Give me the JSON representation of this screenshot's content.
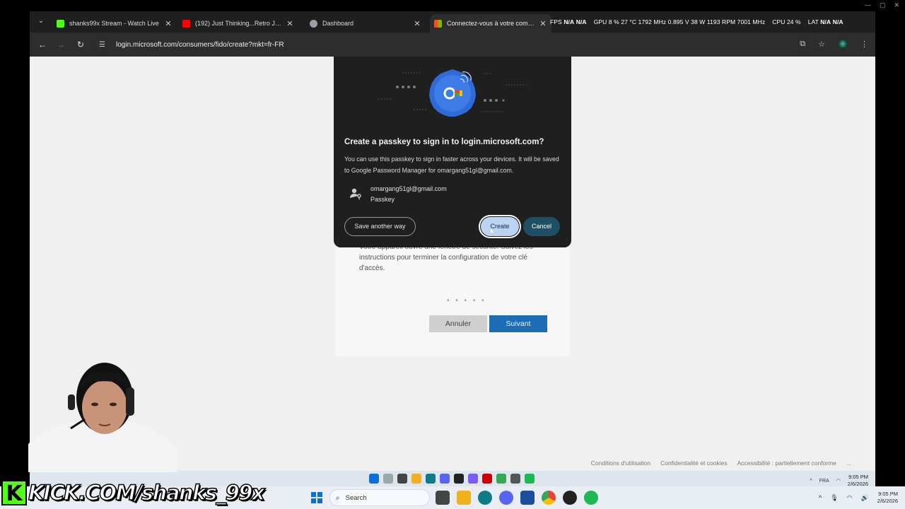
{
  "browser": {
    "tabs": [
      {
        "title": "shanks99x Stream - Watch Live",
        "favicon_color": "#53fc18",
        "active": false
      },
      {
        "title": "(192) Just Thinking...Retro Jazz",
        "favicon_color": "#ff0000",
        "active": false
      },
      {
        "title": "Dashboard",
        "favicon_color": "#9aa0a6",
        "active": false
      },
      {
        "title": "Connectez-vous à votre compte",
        "favicon_color": "#f25022",
        "active": true
      }
    ],
    "url": "login.microsoft.com/consumers/fido/create?mkt=fr-FR"
  },
  "overlay_stats": {
    "fps": "FPS",
    "fps_value": "N/A",
    "fps_value2": "N/A",
    "gpu": "GPU",
    "gpu_load": "8 %",
    "gpu_temp": "27 °C",
    "gpu_clock": "1792 MHz",
    "gpu_volt": "0.895 V",
    "gpu_power": "38 W",
    "gpu_rpm": "1193 RPM",
    "gpu_mem": "7001 MHz",
    "cpu": "CPU",
    "cpu_load": "24 %",
    "lat": "LAT",
    "lat_value": "N/A",
    "lat_value2": "N/A"
  },
  "passkey_dialog": {
    "title": "Create a passkey to sign in to login.microsoft.com?",
    "description": "You can use this passkey to sign in faster across your devices. It will be saved to Google Password Manager for omargang51gl@gmail.com.",
    "account_email": "omargang51gl@gmail.com",
    "account_type": "Passkey",
    "save_another_way": "Save another way",
    "create": "Create",
    "cancel": "Cancel"
  },
  "ms_page": {
    "instructions": "Votre appareil ouvre une fenêtre de sécurité. Suivez les instructions pour terminer la configuration de votre clé d'accès.",
    "loading_dots": "• • • • •",
    "annuler": "Annuler",
    "suivant": "Suivant",
    "footer": [
      "Conditions d'utilisation",
      "Confidentialité et cookies",
      "Accessibilité : partiellement conforme",
      "..."
    ]
  },
  "stream_overlay": {
    "kick_logo": "K",
    "kick_text": "KICK.COM/shanks_99x"
  },
  "taskbar": {
    "search_placeholder": "Search",
    "language": "FRA",
    "time": "9:05 PM",
    "date": "2/6/2026"
  },
  "mini_taskbar": {
    "language": "FRA",
    "time": "9:05 PM",
    "date": "2/6/2026"
  }
}
